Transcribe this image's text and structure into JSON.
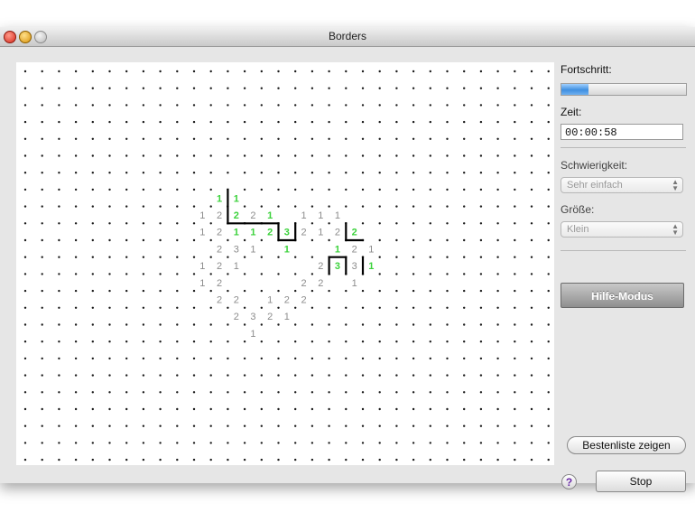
{
  "window": {
    "title": "Borders"
  },
  "sidebar": {
    "progress_label": "Fortschritt:",
    "progress_value": 0.22,
    "time_label": "Zeit:",
    "time_value": "00:00:58",
    "difficulty_label": "Schwierigkeit:",
    "difficulty_value": "Sehr einfach",
    "size_label": "Größe:",
    "size_value": "Klein",
    "help_mode_label": "Hilfe-Modus",
    "highscore_label": "Bestenliste zeigen",
    "help_glyph": "?",
    "stop_label": "Stop"
  },
  "board": {
    "dot_columns": 32,
    "dot_rows": 24,
    "colors": {
      "dot": "#1a1a1a",
      "clue": "#8c8c8c",
      "clue_done": "#3cd23c",
      "edge": "#000000"
    },
    "clues": [
      {
        "c": 11,
        "r": 7,
        "v": "1",
        "done": true
      },
      {
        "c": 12,
        "r": 7,
        "v": "1",
        "done": true
      },
      {
        "c": 10,
        "r": 8,
        "v": "1",
        "done": false
      },
      {
        "c": 11,
        "r": 8,
        "v": "2",
        "done": false
      },
      {
        "c": 12,
        "r": 8,
        "v": "2",
        "done": true
      },
      {
        "c": 13,
        "r": 8,
        "v": "2",
        "done": false
      },
      {
        "c": 14,
        "r": 8,
        "v": "1",
        "done": true
      },
      {
        "c": 16,
        "r": 8,
        "v": "1",
        "done": false
      },
      {
        "c": 17,
        "r": 8,
        "v": "1",
        "done": false
      },
      {
        "c": 18,
        "r": 8,
        "v": "1",
        "done": false
      },
      {
        "c": 10,
        "r": 9,
        "v": "1",
        "done": false
      },
      {
        "c": 11,
        "r": 9,
        "v": "2",
        "done": false
      },
      {
        "c": 12,
        "r": 9,
        "v": "1",
        "done": true
      },
      {
        "c": 13,
        "r": 9,
        "v": "1",
        "done": true
      },
      {
        "c": 14,
        "r": 9,
        "v": "2",
        "done": true
      },
      {
        "c": 15,
        "r": 9,
        "v": "3",
        "done": true
      },
      {
        "c": 16,
        "r": 9,
        "v": "2",
        "done": false
      },
      {
        "c": 17,
        "r": 9,
        "v": "1",
        "done": false
      },
      {
        "c": 18,
        "r": 9,
        "v": "2",
        "done": false
      },
      {
        "c": 19,
        "r": 9,
        "v": "2",
        "done": true
      },
      {
        "c": 11,
        "r": 10,
        "v": "2",
        "done": false
      },
      {
        "c": 12,
        "r": 10,
        "v": "3",
        "done": false
      },
      {
        "c": 13,
        "r": 10,
        "v": "1",
        "done": false
      },
      {
        "c": 15,
        "r": 10,
        "v": "1",
        "done": true
      },
      {
        "c": 18,
        "r": 10,
        "v": "1",
        "done": true
      },
      {
        "c": 19,
        "r": 10,
        "v": "2",
        "done": false
      },
      {
        "c": 20,
        "r": 10,
        "v": "1",
        "done": false
      },
      {
        "c": 10,
        "r": 11,
        "v": "1",
        "done": false
      },
      {
        "c": 11,
        "r": 11,
        "v": "2",
        "done": false
      },
      {
        "c": 12,
        "r": 11,
        "v": "1",
        "done": false
      },
      {
        "c": 17,
        "r": 11,
        "v": "2",
        "done": false
      },
      {
        "c": 18,
        "r": 11,
        "v": "3",
        "done": true
      },
      {
        "c": 19,
        "r": 11,
        "v": "3",
        "done": false
      },
      {
        "c": 20,
        "r": 11,
        "v": "1",
        "done": true
      },
      {
        "c": 10,
        "r": 12,
        "v": "1",
        "done": false
      },
      {
        "c": 11,
        "r": 12,
        "v": "2",
        "done": false
      },
      {
        "c": 16,
        "r": 12,
        "v": "2",
        "done": false
      },
      {
        "c": 17,
        "r": 12,
        "v": "2",
        "done": false
      },
      {
        "c": 19,
        "r": 12,
        "v": "1",
        "done": false
      },
      {
        "c": 11,
        "r": 13,
        "v": "2",
        "done": false
      },
      {
        "c": 12,
        "r": 13,
        "v": "2",
        "done": false
      },
      {
        "c": 14,
        "r": 13,
        "v": "1",
        "done": false
      },
      {
        "c": 15,
        "r": 13,
        "v": "2",
        "done": false
      },
      {
        "c": 16,
        "r": 13,
        "v": "2",
        "done": false
      },
      {
        "c": 12,
        "r": 14,
        "v": "2",
        "done": false
      },
      {
        "c": 13,
        "r": 14,
        "v": "3",
        "done": false
      },
      {
        "c": 14,
        "r": 14,
        "v": "2",
        "done": false
      },
      {
        "c": 15,
        "r": 14,
        "v": "1",
        "done": false
      },
      {
        "c": 13,
        "r": 15,
        "v": "1",
        "done": false
      }
    ],
    "edges": [
      {
        "type": "v",
        "c": 12,
        "r": 7
      },
      {
        "type": "v",
        "c": 12,
        "r": 8
      },
      {
        "type": "h",
        "c": 12,
        "r": 9
      },
      {
        "type": "h",
        "c": 13,
        "r": 9
      },
      {
        "type": "h",
        "c": 14,
        "r": 9
      },
      {
        "type": "v",
        "c": 15,
        "r": 9
      },
      {
        "type": "h",
        "c": 15,
        "r": 10
      },
      {
        "type": "v",
        "c": 16,
        "r": 9
      },
      {
        "type": "v",
        "c": 19,
        "r": 9
      },
      {
        "type": "h",
        "c": 19,
        "r": 10
      },
      {
        "type": "h",
        "c": 18,
        "r": 11
      },
      {
        "type": "v",
        "c": 18,
        "r": 11
      },
      {
        "type": "v",
        "c": 19,
        "r": 11
      },
      {
        "type": "v",
        "c": 20,
        "r": 11
      }
    ]
  }
}
